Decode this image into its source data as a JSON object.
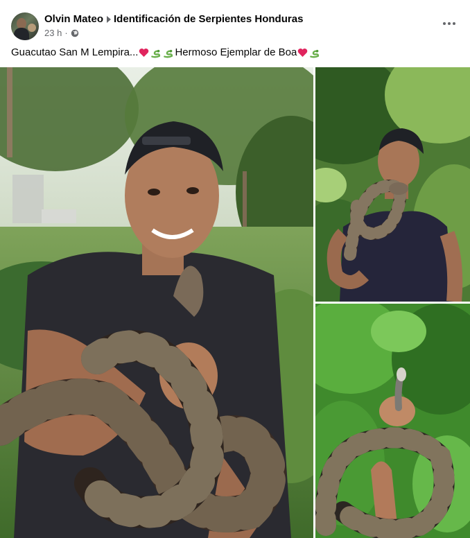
{
  "post": {
    "author": "Olvin Mateo",
    "group": "Identificación de Serpientes Honduras",
    "time": "23 h",
    "caption": {
      "part1": "Guacutao San M Lempira...",
      "part2": "Hermoso Ejemplar de Boa"
    }
  },
  "icons": {
    "more": "more-options-icon",
    "audience": "globe-icon",
    "emoji_heart": "red-heart",
    "emoji_snake": "snake"
  },
  "colors": {
    "text_primary": "#050505",
    "text_secondary": "#65676b",
    "heart": "#e0245e",
    "snake_emoji": "#6ab04c"
  }
}
